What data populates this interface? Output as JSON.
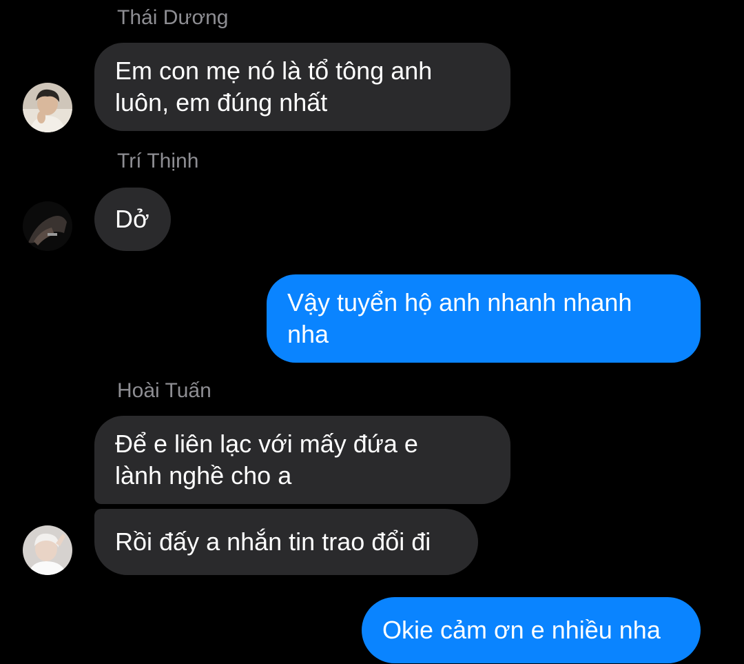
{
  "chat": {
    "senders": {
      "thai_duong": "Thái Dương",
      "tri_thinh": "Trí Thịnh",
      "hoai_tuan": "Hoài Tuấn"
    },
    "messages": [
      {
        "direction": "incoming",
        "sender": "Thái Dương",
        "lines": [
          "Em con mẹ nó là tổ tông anh",
          "luôn, em đúng nhất"
        ]
      },
      {
        "direction": "incoming",
        "sender": "Trí Thịnh",
        "lines": [
          "Dở"
        ]
      },
      {
        "direction": "outgoing",
        "lines": [
          "Vậy tuyển hộ anh nhanh nhanh",
          "nha"
        ]
      },
      {
        "direction": "incoming",
        "sender": "Hoài Tuấn",
        "lines": [
          "Để e liên lạc với mấy đứa e",
          "lành nghề cho a"
        ]
      },
      {
        "direction": "incoming",
        "sender": "Hoài Tuấn",
        "lines": [
          "Rồi đấy a nhắn tin trao đổi đi"
        ]
      },
      {
        "direction": "outgoing",
        "lines": [
          "Okie cảm ơn e nhiều nha"
        ]
      }
    ]
  },
  "colors": {
    "background": "#000000",
    "incoming_bubble": "#2a2a2c",
    "outgoing_bubble": "#0a84ff",
    "sender_name": "#8e8e93",
    "message_text": "#ffffff"
  },
  "icons": {
    "avatars": [
      "thai-duong-avatar",
      "tri-thinh-avatar",
      "hoai-tuan-avatar"
    ]
  }
}
